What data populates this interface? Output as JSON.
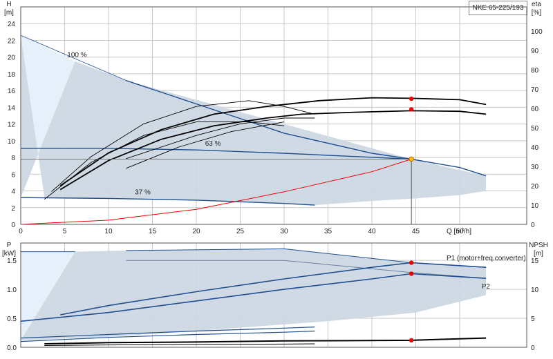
{
  "header": {
    "model": "NKE 65-225/193"
  },
  "colors": {
    "grid": "#c8c8c8",
    "fill": "#cdd8e3",
    "fill_light": "#e6f0fa",
    "blue": "#1f4f8f",
    "red": "#ee0000",
    "black": "#000000",
    "duty": "#f5c400"
  },
  "chart_data": [
    {
      "type": "line",
      "name": "Q-H / efficiency",
      "x_axis": {
        "label": "Q [m³/h]",
        "range": [
          0,
          60
        ],
        "ticks": [
          0,
          5,
          10,
          15,
          20,
          25,
          30,
          35,
          40,
          45,
          50
        ]
      },
      "y_left": {
        "label": "H",
        "unit": "[m]",
        "range": [
          0,
          26
        ],
        "ticks": [
          0,
          2,
          4,
          6,
          8,
          10,
          12,
          14,
          16,
          18,
          20,
          22,
          24
        ]
      },
      "y_right": {
        "label": "eta",
        "unit": "[%]",
        "range": [
          0,
          112.5
        ],
        "ticks": [
          0,
          10,
          20,
          30,
          40,
          50,
          60,
          70,
          80,
          90,
          100
        ]
      },
      "speed_labels": [
        {
          "text": "100 %",
          "x": 5.3,
          "y": 20
        },
        {
          "text": "63 %",
          "x": 21,
          "y": 9.4
        },
        {
          "text": "37 %",
          "x": 13,
          "y": 3.6
        }
      ],
      "speed_curves": [
        {
          "speed": "100 %",
          "x": [
            12,
            20,
            30,
            40,
            44.5,
            50,
            53
          ],
          "y": [
            17.2,
            14.4,
            10.9,
            8.5,
            7.8,
            6.8,
            5.8
          ]
        },
        {
          "speed": "63 %",
          "x": [
            0,
            10,
            20,
            30,
            44.5
          ],
          "y": [
            9.1,
            9.1,
            8.9,
            8.5,
            7.8
          ]
        },
        {
          "speed": "37 %",
          "x": [
            0,
            10,
            20,
            30,
            33.5
          ],
          "y": [
            3.2,
            3.1,
            2.9,
            2.5,
            2.3
          ]
        }
      ],
      "envelope": {
        "x": [
          0,
          0,
          6.2,
          12,
          44.5,
          53,
          53,
          50,
          45,
          40,
          33.5,
          20,
          10,
          2.7
        ],
        "y": [
          22.6,
          3.2,
          19.5,
          17.2,
          7.8,
          5.8,
          4.0,
          3.5,
          3.1,
          2.8,
          2.3,
          2.9,
          3.1,
          3.2
        ]
      },
      "system_curve": {
        "x": [
          0,
          10,
          20,
          30,
          40,
          44.5
        ],
        "y": [
          0,
          0.5,
          1.8,
          3.9,
          6.3,
          7.8
        ]
      },
      "eta_curves": [
        {
          "x": [
            3.5,
            8,
            14,
            20,
            26,
            30,
            33.5
          ],
          "y": [
            17,
            35,
            52,
            61,
            64,
            61,
            57
          ]
        },
        {
          "x": [
            2.7,
            8,
            14,
            20,
            26,
            30
          ],
          "y": [
            13,
            32,
            46,
            53,
            53,
            51
          ]
        },
        {
          "x": [
            4.5,
            10,
            16,
            22,
            28,
            32,
            38,
            44.5,
            50,
            53
          ],
          "y": [
            18,
            33,
            44,
            51,
            55,
            57,
            58,
            58.8,
            58.5,
            57
          ]
        },
        {
          "x": [
            4.5,
            10,
            16,
            22,
            28,
            34,
            40,
            44.5,
            50,
            53
          ],
          "y": [
            20,
            37,
            49,
            57,
            61,
            64,
            65.5,
            65.2,
            64.5,
            62
          ]
        },
        {
          "x": [
            12,
            20,
            25,
            30,
            33.5
          ],
          "y": [
            34,
            46,
            52,
            55,
            55
          ]
        },
        {
          "x": [
            12,
            18,
            24,
            30
          ],
          "y": [
            29,
            40,
            48,
            53
          ]
        }
      ],
      "points": [
        {
          "x": 44.5,
          "y": 7.8,
          "role": "duty point"
        },
        {
          "x": 44.5,
          "eta": 65,
          "role": "eta marker"
        },
        {
          "x": 44.5,
          "eta": 59.5,
          "role": "eta marker"
        }
      ],
      "reference_lines": {
        "duty_h": 7.8,
        "duty_q": 44.5
      }
    },
    {
      "type": "line",
      "name": "Power / NPSH",
      "x_axis": {
        "range": [
          0,
          60
        ]
      },
      "y_left": {
        "label": "P",
        "unit": "[kW]",
        "range": [
          0,
          1.8
        ],
        "ticks": [
          0.0,
          0.5,
          1.0,
          1.5
        ],
        "tick_labels": [
          "0.0",
          "0.5",
          "1.0",
          "1.5"
        ]
      },
      "y_right": {
        "label": "NPSH",
        "unit": "[m]",
        "range": [
          0,
          18
        ],
        "ticks": [
          0,
          5,
          10,
          15
        ]
      },
      "series": [
        {
          "name": "P1 (motor+freq.converter)",
          "x": [
            4.5,
            10,
            20,
            30,
            40,
            44.5,
            53
          ],
          "y": [
            0.56,
            0.72,
            0.96,
            1.18,
            1.38,
            1.46,
            1.38
          ]
        },
        {
          "name": "P2",
          "x": [
            0,
            10,
            20,
            30,
            40,
            44.5,
            53
          ],
          "y": [
            0.45,
            0.6,
            0.8,
            1.0,
            1.18,
            1.27,
            1.19
          ]
        },
        {
          "name": "",
          "x": [
            0,
            10,
            20,
            30,
            33.5
          ],
          "y": [
            0.16,
            0.22,
            0.28,
            0.33,
            0.35
          ]
        },
        {
          "name": "",
          "x": [
            0,
            10,
            20,
            30,
            33.5
          ],
          "y": [
            0.1,
            0.17,
            0.22,
            0.26,
            0.28
          ]
        },
        {
          "name": "NPSH",
          "x": [
            2.7,
            10,
            20,
            30,
            44.5,
            53
          ],
          "npsh": [
            0.6,
            0.8,
            0.9,
            1.1,
            1.2,
            1.6
          ]
        }
      ],
      "envelope": {
        "x": [
          0,
          0,
          6.2,
          12,
          30,
          44.5,
          53,
          53,
          45,
          35,
          26,
          20,
          10,
          0
        ],
        "y": [
          1.65,
          0.12,
          1.65,
          1.67,
          1.7,
          1.46,
          1.38,
          0.9,
          0.6,
          0.45,
          0.35,
          0.28,
          0.18,
          0.12
        ]
      },
      "points": [
        {
          "x": 44.5,
          "y": 1.46
        },
        {
          "x": 44.5,
          "y": 1.27
        },
        {
          "x": 44.5,
          "npsh": 1.2
        }
      ]
    }
  ]
}
